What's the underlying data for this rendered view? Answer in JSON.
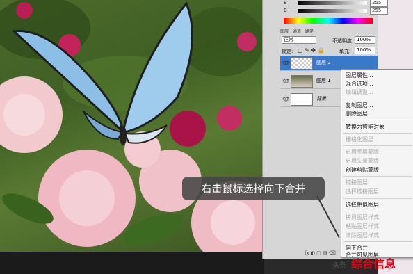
{
  "panel": {
    "sliders": [
      {
        "label": "B",
        "value": "255"
      },
      {
        "label": "B",
        "value": "255"
      }
    ],
    "tabs": [
      "图层",
      "通道",
      "路径"
    ],
    "blend_mode": "正常",
    "opacity_label": "不透明度:",
    "opacity_value": "100%",
    "lock_label": "锁定:",
    "fill_label": "填充:",
    "fill_value": "100%",
    "layers": [
      {
        "name": "图层 2",
        "selected": true
      },
      {
        "name": "图层 1",
        "selected": false
      },
      {
        "name": "背景",
        "selected": false
      }
    ],
    "footer_icons": "fx  ◐  ▢  ▤  ⌫"
  },
  "context_menu": {
    "items": [
      {
        "label": "图层属性...",
        "enabled": true
      },
      {
        "label": "混合选项...",
        "enabled": true
      },
      {
        "label": "编辑调整...",
        "enabled": false
      },
      {
        "label": "复制图层...",
        "enabled": true
      },
      {
        "label": "删除图层",
        "enabled": true
      },
      {
        "label": "转换为智能对象",
        "enabled": true
      },
      {
        "label": "栅格化图层",
        "enabled": false
      },
      {
        "label": "启用图层蒙版",
        "enabled": false
      },
      {
        "label": "启用矢量蒙版",
        "enabled": false
      },
      {
        "label": "创建剪贴蒙版",
        "enabled": true
      },
      {
        "label": "链接图层",
        "enabled": false
      },
      {
        "label": "选择链接图层",
        "enabled": false
      },
      {
        "label": "选择相似图层",
        "enabled": true
      },
      {
        "label": "拷贝图层样式",
        "enabled": false
      },
      {
        "label": "粘贴图层样式",
        "enabled": false
      },
      {
        "label": "清除图层样式",
        "enabled": false
      },
      {
        "label": "向下合并",
        "enabled": true
      },
      {
        "label": "合并可见图层",
        "enabled": true
      }
    ]
  },
  "callout": {
    "text": "右击鼠标选择向下合并"
  },
  "watermark": {
    "prefix": "头条",
    "logo": "综合信息"
  }
}
